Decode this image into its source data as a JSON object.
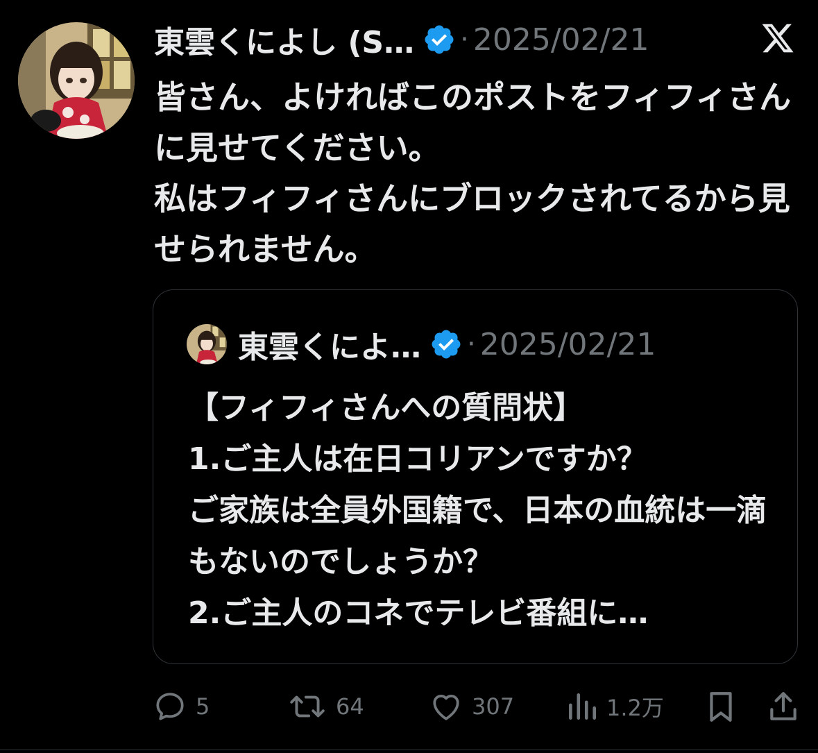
{
  "post": {
    "author_name": "東雲くによし (S…",
    "date": "2025/02/21",
    "separator": "·",
    "verified_icon": "verified-badge-icon",
    "platform_icon": "x-logo-icon",
    "text": "皆さん、よければこのポストをフィフィさんに見せてください。\n私はフィフィさんにブロックされてるから見せられません。"
  },
  "quoted_post": {
    "author_name": "東雲くによ…",
    "date": "2025/02/21",
    "separator": "·",
    "text": "【フィフィさんへの質問状】\n1.ご主人は在日コリアンですか？\nご家族は全員外国籍で、日本の血統は一滴もないのでしょうか？\n2.ご主人のコネでテレビ番組に…"
  },
  "actions": {
    "replies": "5",
    "reposts": "64",
    "likes": "307",
    "views": "1.2万"
  },
  "colors": {
    "background": "#000000",
    "text": "#e7e9ea",
    "secondary": "#71767b",
    "verified": "#1d9bf0",
    "border": "#2f3336"
  }
}
